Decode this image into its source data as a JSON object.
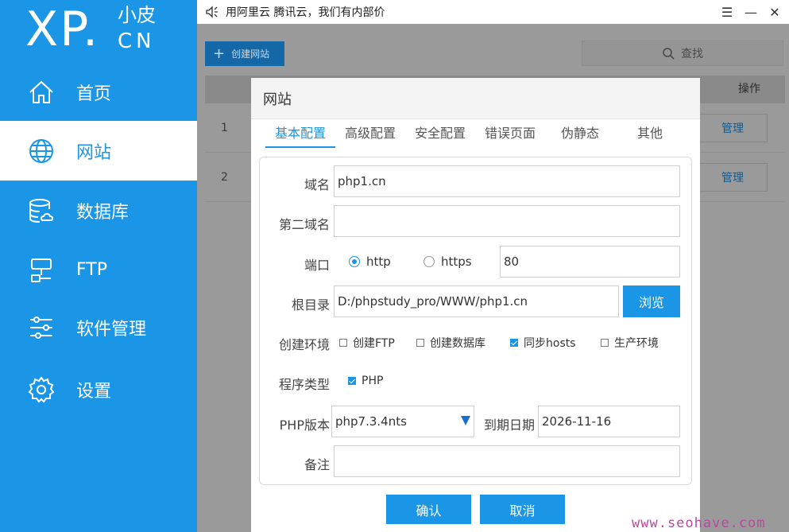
{
  "logo": {
    "main": "XP.",
    "cn_top": "小皮",
    "cn_bottom": "CN"
  },
  "sidebar": {
    "items": [
      {
        "label": "首页",
        "icon": "home-icon"
      },
      {
        "label": "网站",
        "icon": "globe-icon",
        "active": true
      },
      {
        "label": "数据库",
        "icon": "database-icon"
      },
      {
        "label": "FTP",
        "icon": "ftp-icon"
      },
      {
        "label": "软件管理",
        "icon": "sliders-icon"
      },
      {
        "label": "设置",
        "icon": "gear-icon"
      }
    ]
  },
  "titlebar": {
    "title": "用阿里云 腾讯云，我们有内部价",
    "menu_icon": "☰",
    "min_icon": "—",
    "close_icon": "✕"
  },
  "toolbar": {
    "create_label": "创建网站",
    "search_placeholder": "查找"
  },
  "table": {
    "op_header": "操作",
    "rows": [
      {
        "index": "1",
        "action": "管理"
      },
      {
        "index": "2",
        "action": "管理"
      }
    ]
  },
  "modal": {
    "title": "网站",
    "tabs": [
      "基本配置",
      "高级配置",
      "安全配置",
      "错误页面",
      "伪静态",
      "其他"
    ],
    "form": {
      "domain_label": "域名",
      "domain_value": "php1.cn",
      "second_domain_label": "第二域名",
      "second_domain_value": "",
      "port_label": "端口",
      "port_http": "http",
      "port_https": "https",
      "port_value": "80",
      "root_label": "根目录",
      "root_value": "D:/phpstudy_pro/WWW/php1.cn",
      "browse_label": "浏览",
      "env_label": "创建环境",
      "env_options": [
        {
          "label": "创建FTP",
          "checked": false
        },
        {
          "label": "创建数据库",
          "checked": false
        },
        {
          "label": "同步hosts",
          "checked": true
        },
        {
          "label": "生产环境",
          "checked": false
        }
      ],
      "program_label": "程序类型",
      "program_option": "PHP",
      "php_label": "PHP版本",
      "php_value": "php7.3.4nts",
      "expiry_label": "到期日期",
      "expiry_value": "2026-11-16",
      "note_label": "备注",
      "note_value": ""
    },
    "confirm_label": "确认",
    "cancel_label": "取消"
  },
  "watermark": "www.seohave.com",
  "colors": {
    "accent": "#1b95e5",
    "overlay": "#9a9a9a"
  }
}
